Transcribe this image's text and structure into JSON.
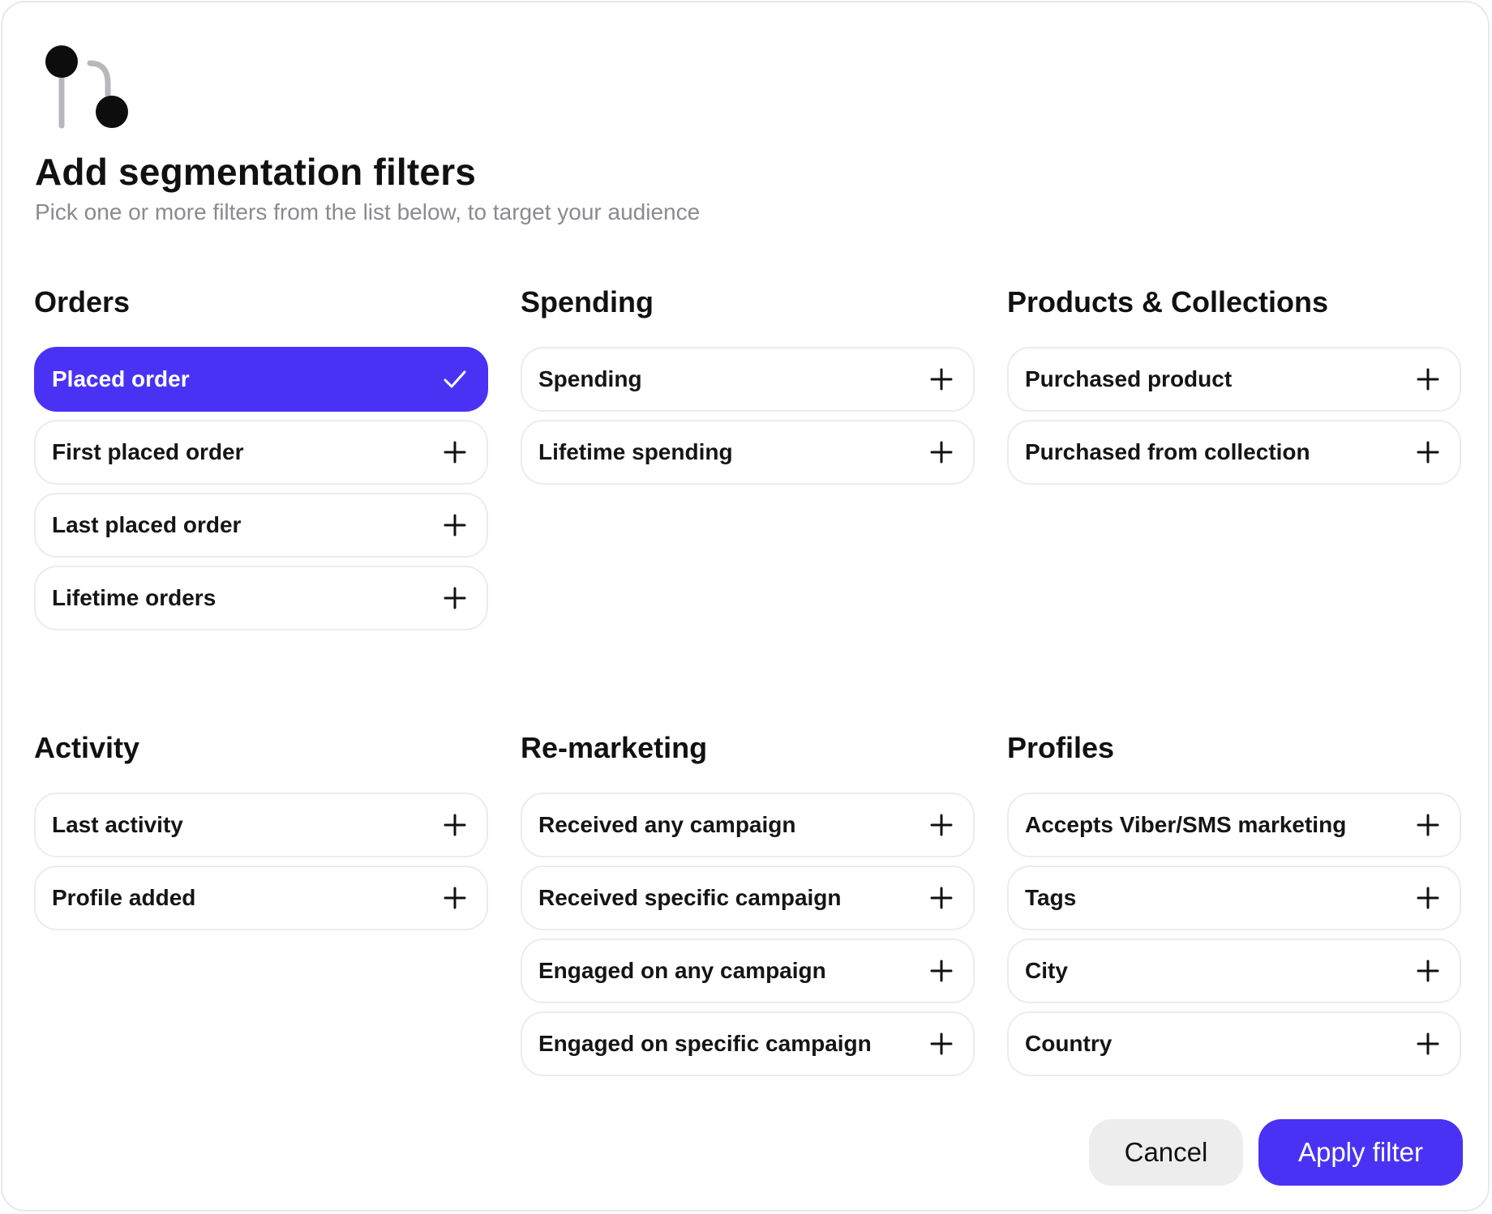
{
  "header": {
    "title": "Add segmentation filters",
    "subtitle": "Pick one or more filters from the list below, to target your audience"
  },
  "colors": {
    "accent": "#4a32f5",
    "border": "#ececef",
    "muted_text": "#8a8a90",
    "cancel_bg": "#ededee"
  },
  "sections": [
    {
      "title": "Orders",
      "items": [
        {
          "label": "Placed order",
          "selected": true
        },
        {
          "label": "First placed order",
          "selected": false
        },
        {
          "label": "Last placed order",
          "selected": false
        },
        {
          "label": "Lifetime orders",
          "selected": false
        }
      ]
    },
    {
      "title": "Spending",
      "items": [
        {
          "label": "Spending",
          "selected": false
        },
        {
          "label": "Lifetime spending",
          "selected": false
        }
      ]
    },
    {
      "title": "Products & Collections",
      "items": [
        {
          "label": "Purchased product",
          "selected": false
        },
        {
          "label": "Purchased from collection",
          "selected": false
        }
      ]
    },
    {
      "title": "Activity",
      "items": [
        {
          "label": "Last activity",
          "selected": false
        },
        {
          "label": "Profile added",
          "selected": false
        }
      ]
    },
    {
      "title": "Re-marketing",
      "items": [
        {
          "label": "Received any campaign",
          "selected": false
        },
        {
          "label": "Received specific campaign",
          "selected": false
        },
        {
          "label": "Engaged on any campaign",
          "selected": false
        },
        {
          "label": "Engaged on specific campaign",
          "selected": false
        }
      ]
    },
    {
      "title": "Profiles",
      "items": [
        {
          "label": "Accepts Viber/SMS marketing",
          "selected": false
        },
        {
          "label": "Tags",
          "selected": false
        },
        {
          "label": "City",
          "selected": false
        },
        {
          "label": "Country",
          "selected": false
        }
      ]
    }
  ],
  "icons": {
    "logo": "segmentation-branch-icon",
    "selected": "check-icon",
    "unselected": "plus-icon"
  },
  "footer": {
    "cancel_label": "Cancel",
    "apply_label": "Apply filter"
  }
}
